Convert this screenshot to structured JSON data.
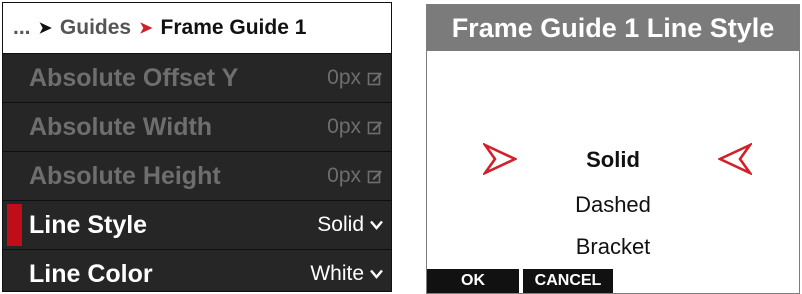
{
  "breadcrumb": {
    "ellipsis": "...",
    "parent": "Guides",
    "current": "Frame Guide 1"
  },
  "menu": {
    "items": [
      {
        "label": "Absolute Offset Y",
        "value": "0px",
        "state": "disabled",
        "icon": "edit-icon"
      },
      {
        "label": "Absolute Width",
        "value": "0px",
        "state": "disabled",
        "icon": "edit-icon"
      },
      {
        "label": "Absolute Height",
        "value": "0px",
        "state": "disabled",
        "icon": "edit-icon"
      },
      {
        "label": "Line Style",
        "value": "Solid",
        "state": "selected",
        "icon": "chevron-down-icon"
      },
      {
        "label": "Line Color",
        "value": "White",
        "state": "normal",
        "icon": "chevron-down-icon"
      }
    ]
  },
  "dialog": {
    "title": "Frame Guide 1 Line Style",
    "options": [
      "Solid",
      "Dashed",
      "Bracket"
    ],
    "selected": "Solid",
    "ok_label": "OK",
    "cancel_label": "CANCEL"
  },
  "colors": {
    "accent_red": "#d0202a",
    "selection_bar": "#c00d1a",
    "menu_bg": "#262626",
    "dialog_title_bg": "#7b7b7b"
  }
}
